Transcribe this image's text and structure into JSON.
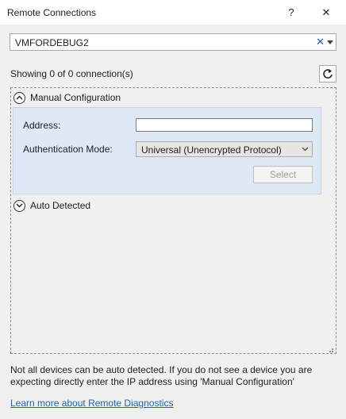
{
  "window": {
    "title": "Remote Connections",
    "help_label": "?",
    "close_label": "✕"
  },
  "device_combo": {
    "value": "VMFORDEBUG2",
    "clear_label": "✕"
  },
  "status": {
    "showing_text": "Showing 0 of 0 connection(s)"
  },
  "manual": {
    "header_label": "Manual Configuration",
    "address_label": "Address:",
    "address_value": "",
    "auth_mode_label": "Authentication Mode:",
    "auth_mode_value": "Universal (Unencrypted Protocol)",
    "select_label": "Select"
  },
  "auto": {
    "header_label": "Auto Detected"
  },
  "footer": {
    "note": "Not all devices can be auto detected. If you do not see a device you are expecting directly enter the IP address using 'Manual Configuration'",
    "link_label": "Learn more about Remote Diagnostics"
  },
  "colors": {
    "manual_panel_bg": "#dfe9f5",
    "link": "#1a64b4",
    "clear_x": "#1e5fb4"
  },
  "icons": {
    "help": "help-icon",
    "close": "close-icon",
    "clear": "clear-icon",
    "dropdown": "chevron-down-icon",
    "refresh": "refresh-icon",
    "collapse": "chevron-up-circle-icon",
    "expand": "chevron-down-circle-icon",
    "resize": "resize-grip-icon"
  }
}
